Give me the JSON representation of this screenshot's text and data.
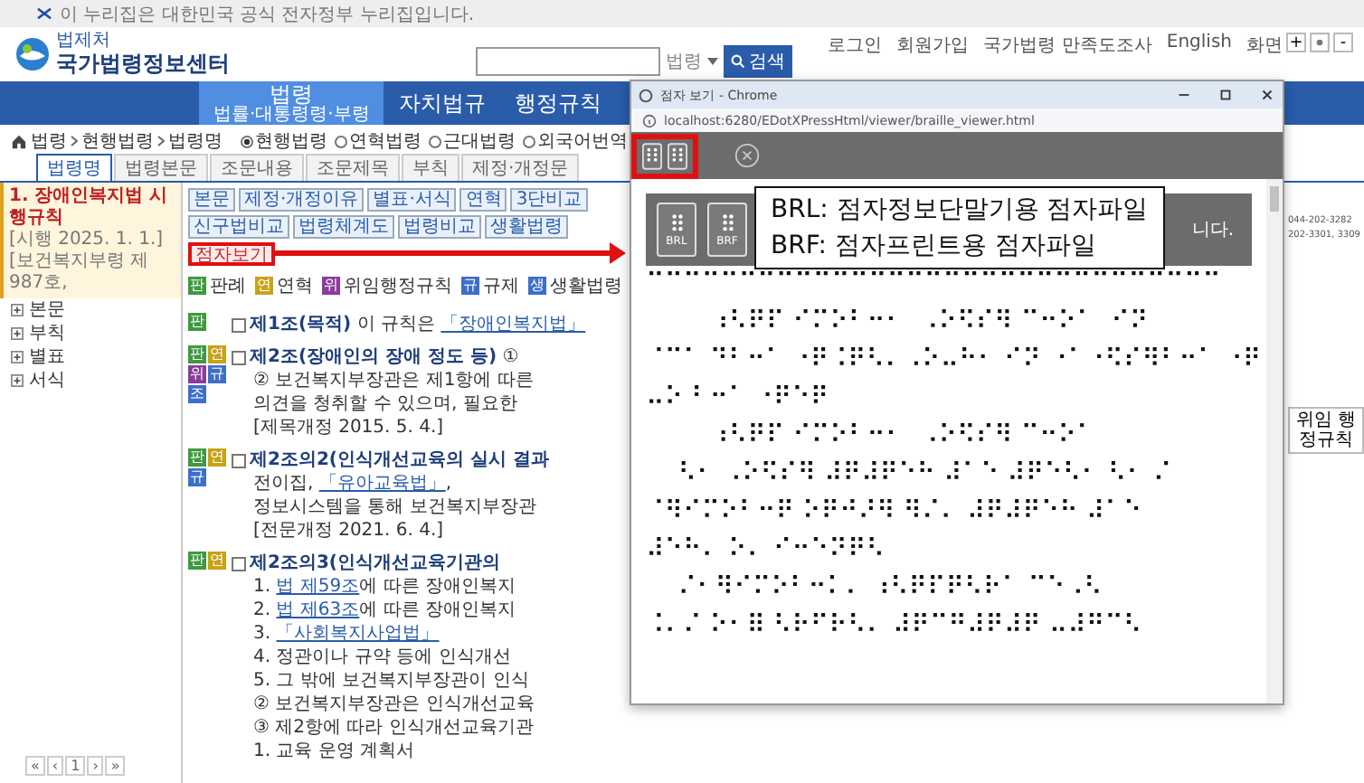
{
  "notice": "이 누리집은 대한민국 공식 전자정부 누리집입니다.",
  "utility_links": [
    "로그인",
    "회원가입",
    "국가법령 만족도조사",
    "English"
  ],
  "zoom": {
    "label": "화면",
    "buttons": [
      "+",
      "-"
    ]
  },
  "logo": {
    "org": "법제처",
    "name": "국가법령정보센터"
  },
  "search": {
    "scope": "법령",
    "button": "검색"
  },
  "nav": [
    {
      "label": "법령",
      "sub": "법률·대통령령·부령",
      "selected": true
    },
    {
      "label": "자치법규",
      "selected": false
    },
    {
      "label": "행정규칙",
      "selected": false
    }
  ],
  "breadcrumb": [
    "법령",
    "현행법령",
    "법령명"
  ],
  "search_types": [
    {
      "label": "현행법령",
      "selected": true
    },
    {
      "label": "연혁법령",
      "selected": false
    },
    {
      "label": "근대법령",
      "selected": false
    },
    {
      "label": "외국어번역",
      "selected": false
    }
  ],
  "tabs": [
    {
      "label": "법령명",
      "selected": true
    },
    {
      "label": "법령본문",
      "selected": false
    },
    {
      "label": "조문내용",
      "selected": false
    },
    {
      "label": "조문제목",
      "selected": false
    },
    {
      "label": "부칙",
      "selected": false
    },
    {
      "label": "제정·개정문",
      "selected": false
    }
  ],
  "law": {
    "title": "1. 장애인복지법 시행규칙",
    "meta": "[시행 2025. 1. 1.] [보건복지부령 제987호,"
  },
  "outline": [
    "본문",
    "부칙",
    "별표",
    "서식"
  ],
  "pager": [
    "«",
    "‹",
    "1",
    "›",
    "»"
  ],
  "toolbar": [
    {
      "label": "본문",
      "highlighted": false
    },
    {
      "label": "제정·개정이유",
      "highlighted": false
    },
    {
      "label": "별표·서식",
      "highlighted": false
    },
    {
      "label": "연혁",
      "highlighted": false
    },
    {
      "label": "3단비교",
      "highlighted": false
    },
    {
      "label": "신구법비교",
      "highlighted": false
    },
    {
      "label": "법령체계도",
      "highlighted": false
    },
    {
      "label": "법령비교",
      "highlighted": false
    },
    {
      "label": "생활법령",
      "highlighted": false
    },
    {
      "label": "점자보기",
      "highlighted": true
    }
  ],
  "legend": [
    {
      "badge": "판",
      "label": "판례",
      "color": "#3d9a3d"
    },
    {
      "badge": "연",
      "label": "연혁",
      "color": "#c9a21a"
    },
    {
      "badge": "위",
      "label": "위임행정규칙",
      "color": "#8a3d9a"
    },
    {
      "badge": "규",
      "label": "규제",
      "color": "#3d6fc9"
    },
    {
      "badge": "생",
      "label": "생활법령",
      "color": "#3d6fc9"
    }
  ],
  "articles": [
    {
      "badges": [
        {
          "text": "판",
          "color": "#3d9a3d"
        }
      ],
      "checked": false,
      "lines": [
        [
          {
            "kind": "heading",
            "text": "제1조(목적)"
          },
          {
            "kind": "text",
            "text": " 이 규칙은 "
          },
          {
            "kind": "link",
            "text": "「장애인복지법」"
          }
        ]
      ]
    },
    {
      "badges": [
        {
          "text": "판",
          "color": "#3d9a3d"
        },
        {
          "text": "연",
          "color": "#c9a21a"
        },
        {
          "text": "위",
          "color": "#8a3d9a"
        },
        {
          "text": "규",
          "color": "#3d6fc9"
        },
        {
          "text": "조",
          "color": "#3d6fc9"
        }
      ],
      "checked": false,
      "lines": [
        [
          {
            "kind": "heading",
            "text": "제2조(장애인의 장애 정도 등)"
          },
          {
            "kind": "text",
            "text": " ①"
          }
        ],
        [
          {
            "kind": "text",
            "text": "② 보건복지부장관은 제1항에 따른"
          }
        ],
        [
          {
            "kind": "text",
            "text": "의견을 청취할 수 있으며, 필요한"
          }
        ],
        [
          {
            "kind": "text",
            "text": "[제목개정 2015. 5. 4.]"
          }
        ]
      ]
    },
    {
      "badges": [
        {
          "text": "판",
          "color": "#3d9a3d"
        },
        {
          "text": "연",
          "color": "#c9a21a"
        },
        {
          "text": "규",
          "color": "#3d6fc9"
        }
      ],
      "checked": false,
      "lines": [
        [
          {
            "kind": "heading",
            "text": "제2조의2(인식개선교육의 실시 결과"
          }
        ],
        [
          {
            "kind": "text",
            "text": "전이집, "
          },
          {
            "kind": "link",
            "text": "「유아교육법」"
          },
          {
            "kind": "text",
            "text": ", "
          }
        ],
        [
          {
            "kind": "text",
            "text": "정보시스템을 통해 보건복지부장관"
          }
        ],
        [
          {
            "kind": "text",
            "text": "[전문개정 2021. 6. 4.]"
          }
        ]
      ]
    },
    {
      "badges": [
        {
          "text": "판",
          "color": "#3d9a3d"
        },
        {
          "text": "연",
          "color": "#c9a21a"
        }
      ],
      "checked": false,
      "lines": [
        [
          {
            "kind": "heading",
            "text": "제2조의3(인식개선교육기관의"
          }
        ],
        [
          {
            "kind": "text",
            "text": "1. "
          },
          {
            "kind": "link",
            "text": "법 제59조"
          },
          {
            "kind": "text",
            "text": "에 따른 장애인복지"
          }
        ],
        [
          {
            "kind": "text",
            "text": "2. "
          },
          {
            "kind": "link",
            "text": "법 제63조"
          },
          {
            "kind": "text",
            "text": "에 따른 장애인복지"
          }
        ],
        [
          {
            "kind": "text",
            "text": "3. "
          },
          {
            "kind": "link",
            "text": "「사회복지사업법」"
          }
        ],
        [
          {
            "kind": "text",
            "text": "4. 정관이나 규약 등에 인식개선"
          }
        ],
        [
          {
            "kind": "text",
            "text": "5. 그 밖에 보건복지부장관이 인식"
          }
        ],
        [
          {
            "kind": "text",
            "text": "② 보건복지부장관은 인식개선교육"
          }
        ],
        [
          {
            "kind": "text",
            "text": "③ 제2항에 따라 인식개선교육기관"
          }
        ],
        [
          {
            "kind": "text",
            "text": "1. 교육 운영 계획서"
          }
        ]
      ]
    }
  ],
  "side": {
    "contacts": [
      "044-202-3282",
      "202-3301, 3309"
    ],
    "button": "위임 행정규칙"
  },
  "popup": {
    "title": "점자 보기 - Chrome",
    "url": "localhost:6280/EDotXPressHtml/viewer/braille_viewer.html",
    "formats": [
      "BRL",
      "BRF"
    ],
    "banner_text": "니다.",
    "callout": [
      "BRL: 점자정보단말기용 점자파일",
      "BRF: 점자프린트용 점자파일"
    ],
    "braille": [
      "⠉⠉⠉⠉⠉⠉⠉⠉⠉⠉⠉⠉⠉⠉⠉⠉⠉⠉⠉⠉⠉⠉⠉⠉⠉⠉⠉⠉⠉⠉⠉",
      "        ⠰⠣⠟⠏ ⠊⠍⠕⠃⠒⠂  ⠠⠕⠫⠎⠻ ⠉⠒⠕⠁  ⠊⠝",
      "⠈⠉⠁ ⠙⠃⠒⠁ ⠐⠟⠨⠟⠣⠄⠠⠕⠤⠓⠂ ⠊⠝ ⠐⠁⠐⠫⠎⠻⠃⠒⠁ ⠐⠟",
      "⠤⠕ ⠃⠒⠁ ⠐⠟⠑⠟",
      "        ⠰⠣⠟⠏ ⠊⠍⠕⠃⠒⠂  ⠠⠕⠫⠎⠻ ⠉⠒⠕⠁",
      "    ⠣⠂ ⠠⠕⠫⠎⠻ ⠼⠟⠼⠟⠑⠓ ⠼⠁⠑ ⠼⠟⠑⠣⠂ ⠣⠂ ⠌",
      "⠈⠻⠊⠍⠕⠃⠒⠟ ⠕⠟⠚⠜⠻ ⠻⠌⠄ ⠼⠟⠼⠟⠑⠓ ⠼⠁⠑",
      "⠼⠑⠓⠄ ⠕⠄ ⠊⠒⠑⠝⠟⠣",
      "    ⠌⠂⠻⠊⠍⠕⠃⠒⠅⠄ ⠰⠣⠟⠏⠟⠣⠗⠁ ⠉⠑⠠⠣",
      "⠨⠄⠌ ⠕⠂⠿ ⠣⠗⠋⠗⠣⠄ ⠼⠟⠉⠛⠼⠟⠼⠟ ⠤⠼⠛⠉⠣"
    ]
  }
}
